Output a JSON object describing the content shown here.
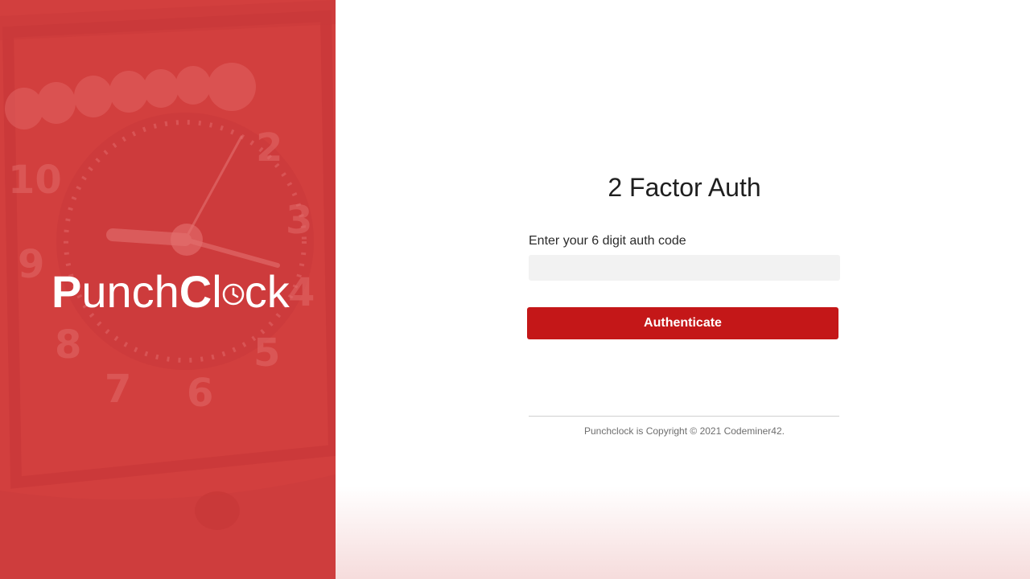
{
  "brand": {
    "logo_part1": "P",
    "logo_part2": "unch",
    "logo_part3": "C",
    "logo_part4": "l",
    "logo_part5": "ck",
    "panel_color": "#d4403f"
  },
  "auth_form": {
    "title": "2 Factor Auth",
    "code_label": "Enter your 6 digit auth code",
    "code_value": "",
    "code_placeholder": "",
    "submit_label": "Authenticate",
    "accent_color": "#c41718"
  },
  "footer": {
    "copyright": "Punchclock is Copyright © 2021 Codeminer42."
  }
}
